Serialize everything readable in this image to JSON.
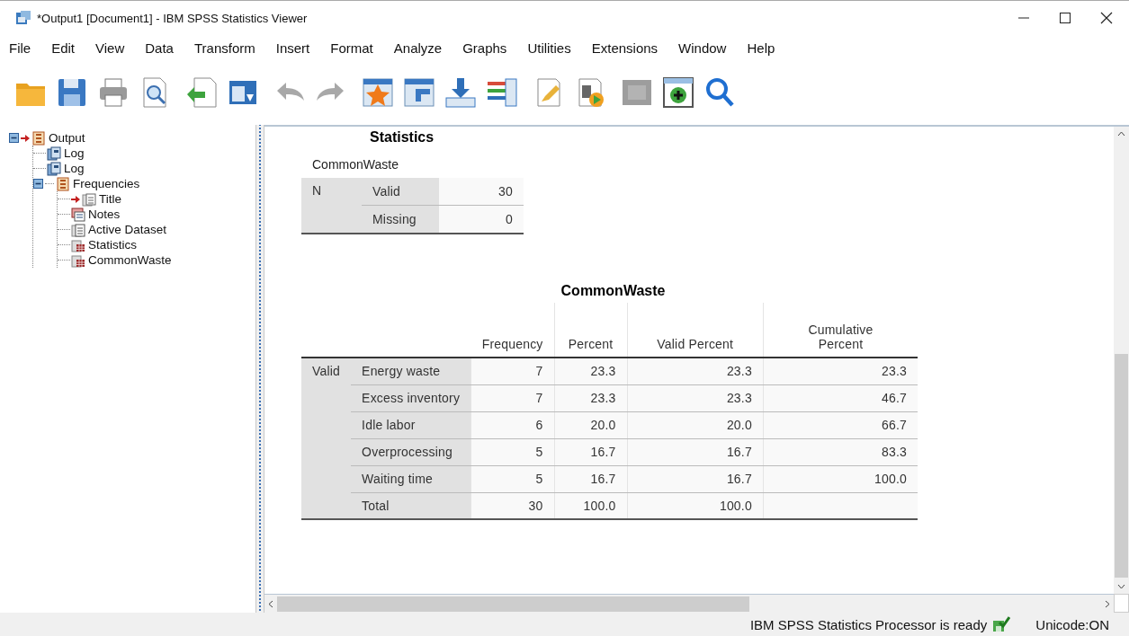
{
  "window": {
    "title": "*Output1 [Document1] - IBM SPSS Statistics Viewer"
  },
  "menu": [
    "File",
    "Edit",
    "View",
    "Data",
    "Transform",
    "Insert",
    "Format",
    "Analyze",
    "Graphs",
    "Utilities",
    "Extensions",
    "Window",
    "Help"
  ],
  "toolbar": [
    [
      {
        "kind": "folder",
        "disabled": false
      },
      {
        "kind": "floppy",
        "disabled": false
      },
      {
        "kind": "printer",
        "disabled": false
      },
      {
        "kind": "preview",
        "disabled": false
      }
    ],
    [
      {
        "kind": "export",
        "disabled": false
      },
      {
        "kind": "window",
        "disabled": false
      }
    ],
    [
      {
        "kind": "undo",
        "disabled": true
      },
      {
        "kind": "redo",
        "disabled": true
      }
    ],
    [
      {
        "kind": "star",
        "disabled": false
      },
      {
        "kind": "gridarrow",
        "disabled": false
      },
      {
        "kind": "download",
        "disabled": false
      },
      {
        "kind": "list",
        "disabled": false
      }
    ],
    [
      {
        "kind": "pencil",
        "disabled": false
      },
      {
        "kind": "play",
        "disabled": false
      }
    ],
    [
      {
        "kind": "square",
        "disabled": true
      },
      {
        "kind": "plus",
        "disabled": false
      },
      {
        "kind": "search",
        "disabled": false
      }
    ]
  ],
  "outline": {
    "label": "Output",
    "kind": "book",
    "expanded": true,
    "current": true,
    "children": [
      {
        "label": "Log",
        "kind": "log",
        "current": false
      },
      {
        "label": "Log",
        "kind": "log",
        "current": false
      },
      {
        "label": "Frequencies",
        "kind": "book",
        "expanded": true,
        "current": false,
        "children": [
          {
            "label": "Title",
            "kind": "title",
            "current": true
          },
          {
            "label": "Notes",
            "kind": "notes",
            "current": false
          },
          {
            "label": "Active Dataset",
            "kind": "text",
            "current": false
          },
          {
            "label": "Statistics",
            "kind": "table",
            "current": false
          },
          {
            "label": "CommonWaste",
            "kind": "table",
            "current": false
          }
        ]
      }
    ]
  },
  "statistics_table": {
    "title": "Statistics",
    "subtitle": "CommonWaste",
    "rows": [
      {
        "group": "N",
        "label": "Valid",
        "value": "30"
      },
      {
        "label": "Missing",
        "value": "0"
      }
    ]
  },
  "frequency_table": {
    "title": "CommonWaste",
    "columns": [
      "Frequency",
      "Percent",
      "Valid Percent",
      "Cumulative Percent"
    ],
    "group": "Valid",
    "rows": [
      {
        "label": "Energy waste",
        "cells": [
          "7",
          "23.3",
          "23.3",
          "23.3"
        ]
      },
      {
        "label": "Excess inventory",
        "cells": [
          "7",
          "23.3",
          "23.3",
          "46.7"
        ]
      },
      {
        "label": "Idle labor",
        "cells": [
          "6",
          "20.0",
          "20.0",
          "66.7"
        ]
      },
      {
        "label": "Overprocessing",
        "cells": [
          "5",
          "16.7",
          "16.7",
          "83.3"
        ]
      },
      {
        "label": "Waiting time",
        "cells": [
          "5",
          "16.7",
          "16.7",
          "100.0"
        ]
      },
      {
        "label": "Total",
        "cells": [
          "30",
          "100.0",
          "100.0"
        ]
      }
    ]
  },
  "status_bar": {
    "message": "IBM SPSS Statistics Processor is ready",
    "encoding": "Unicode:ON"
  }
}
